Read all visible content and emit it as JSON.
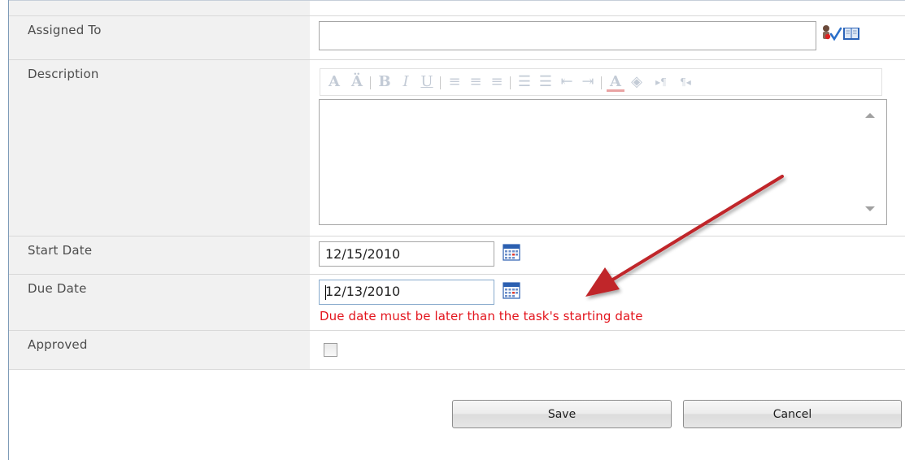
{
  "form": {
    "assigned_to": {
      "label": "Assigned To",
      "value": ""
    },
    "description": {
      "label": "Description",
      "value": ""
    },
    "start_date": {
      "label": "Start Date",
      "value": "12/15/2010"
    },
    "due_date": {
      "label": "Due Date",
      "value": "12/13/2010",
      "error": "Due date must be later than the task's starting date"
    },
    "approved": {
      "label": "Approved",
      "checked": false
    }
  },
  "toolbar": {
    "buttons": [
      {
        "glyph": "A",
        "icon": "font-size-icon"
      },
      {
        "glyph": "Ä",
        "icon": "font-size-increase-icon"
      },
      {
        "glyph": "B",
        "icon": "bold-icon"
      },
      {
        "glyph": "I",
        "icon": "italic-icon"
      },
      {
        "glyph": "U",
        "icon": "underline-icon"
      },
      {
        "glyph": "≡",
        "icon": "align-left-icon"
      },
      {
        "glyph": "≡",
        "icon": "align-center-icon"
      },
      {
        "glyph": "≡",
        "icon": "align-right-icon"
      },
      {
        "glyph": "☰",
        "icon": "numbered-list-icon"
      },
      {
        "glyph": "☰",
        "icon": "bulleted-list-icon"
      },
      {
        "glyph": "⇤",
        "icon": "decrease-indent-icon"
      },
      {
        "glyph": "⇥",
        "icon": "increase-indent-icon"
      },
      {
        "glyph": "A",
        "icon": "font-color-icon"
      },
      {
        "glyph": "◈",
        "icon": "highlight-color-icon"
      },
      {
        "glyph": "▸¶",
        "icon": "ltr-icon"
      },
      {
        "glyph": "¶◂",
        "icon": "rtl-icon"
      }
    ]
  },
  "buttons": {
    "save": "Save",
    "cancel": "Cancel"
  },
  "colors": {
    "error": "#e3141c",
    "arrow": "#c0262c",
    "label_bg": "#f1f1f1"
  }
}
